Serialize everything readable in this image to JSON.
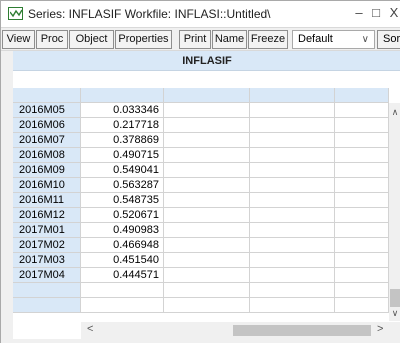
{
  "window": {
    "title": "Series: INFLASIF   Workfile: INFLASI::Untitled\\",
    "min_glyph": "–",
    "max_glyph": "□",
    "close_glyph": "X"
  },
  "toolbar": {
    "view": "View",
    "proc": "Proc",
    "object": "Object",
    "properties": "Properties",
    "print": "Print",
    "name": "Name",
    "freeze": "Freeze",
    "combo_value": "Default",
    "sort": "Sor"
  },
  "grid": {
    "series_name": "INFLASIF",
    "rows": [
      {
        "date": "2016M05",
        "value": "0.033346"
      },
      {
        "date": "2016M06",
        "value": "0.217718"
      },
      {
        "date": "2016M07",
        "value": "0.378869"
      },
      {
        "date": "2016M08",
        "value": "0.490715"
      },
      {
        "date": "2016M09",
        "value": "0.549041"
      },
      {
        "date": "2016M10",
        "value": "0.563287"
      },
      {
        "date": "2016M11",
        "value": "0.548735"
      },
      {
        "date": "2016M12",
        "value": "0.520671"
      },
      {
        "date": "2017M01",
        "value": "0.490983"
      },
      {
        "date": "2017M02",
        "value": "0.466948"
      },
      {
        "date": "2017M03",
        "value": "0.451540"
      },
      {
        "date": "2017M04",
        "value": "0.444571"
      }
    ]
  },
  "scrollbars": {
    "up": "∧",
    "down": "∨",
    "left": "<",
    "right": ">"
  }
}
